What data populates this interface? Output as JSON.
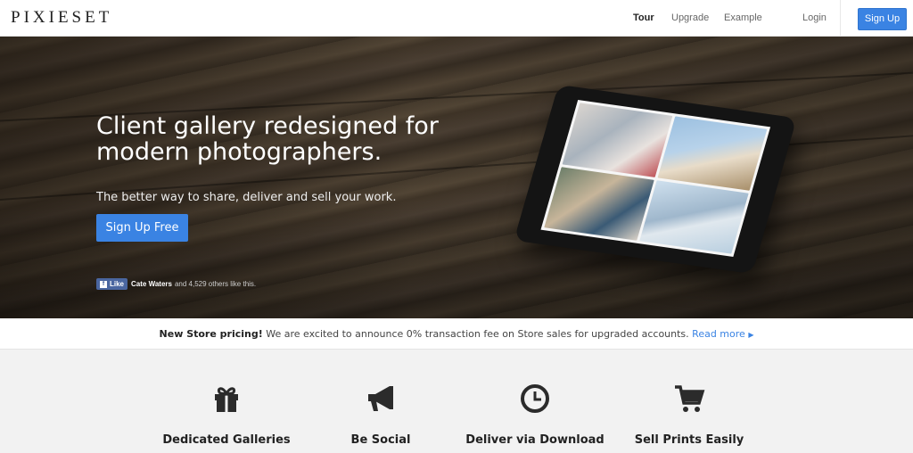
{
  "header": {
    "logo": "PIXIESET",
    "nav": {
      "tour": "Tour",
      "upgrade": "Upgrade",
      "example": "Example",
      "login": "Login"
    },
    "signup_label": "Sign Up"
  },
  "hero": {
    "title": "Client gallery redesigned for modern photographers.",
    "tagline": "The better way to share, deliver and sell your work.",
    "cta_label": "Sign Up Free",
    "facebook": {
      "like_label": "Like",
      "name": "Cate Waters",
      "text": "and 4,529 others like this."
    }
  },
  "announcement": {
    "bold": "New Store pricing!",
    "text": "We are excited to announce 0% transaction fee on Store sales for upgraded accounts.",
    "link": "Read more"
  },
  "features": [
    {
      "icon": "gift-icon",
      "title": "Dedicated Galleries"
    },
    {
      "icon": "megaphone-icon",
      "title": "Be Social"
    },
    {
      "icon": "clock-icon",
      "title": "Deliver via Download"
    },
    {
      "icon": "cart-icon",
      "title": "Sell Prints Easily"
    }
  ],
  "colors": {
    "accent": "#3a83e3",
    "facebook": "#4a66a0",
    "features_bg": "#f2f2f2"
  }
}
